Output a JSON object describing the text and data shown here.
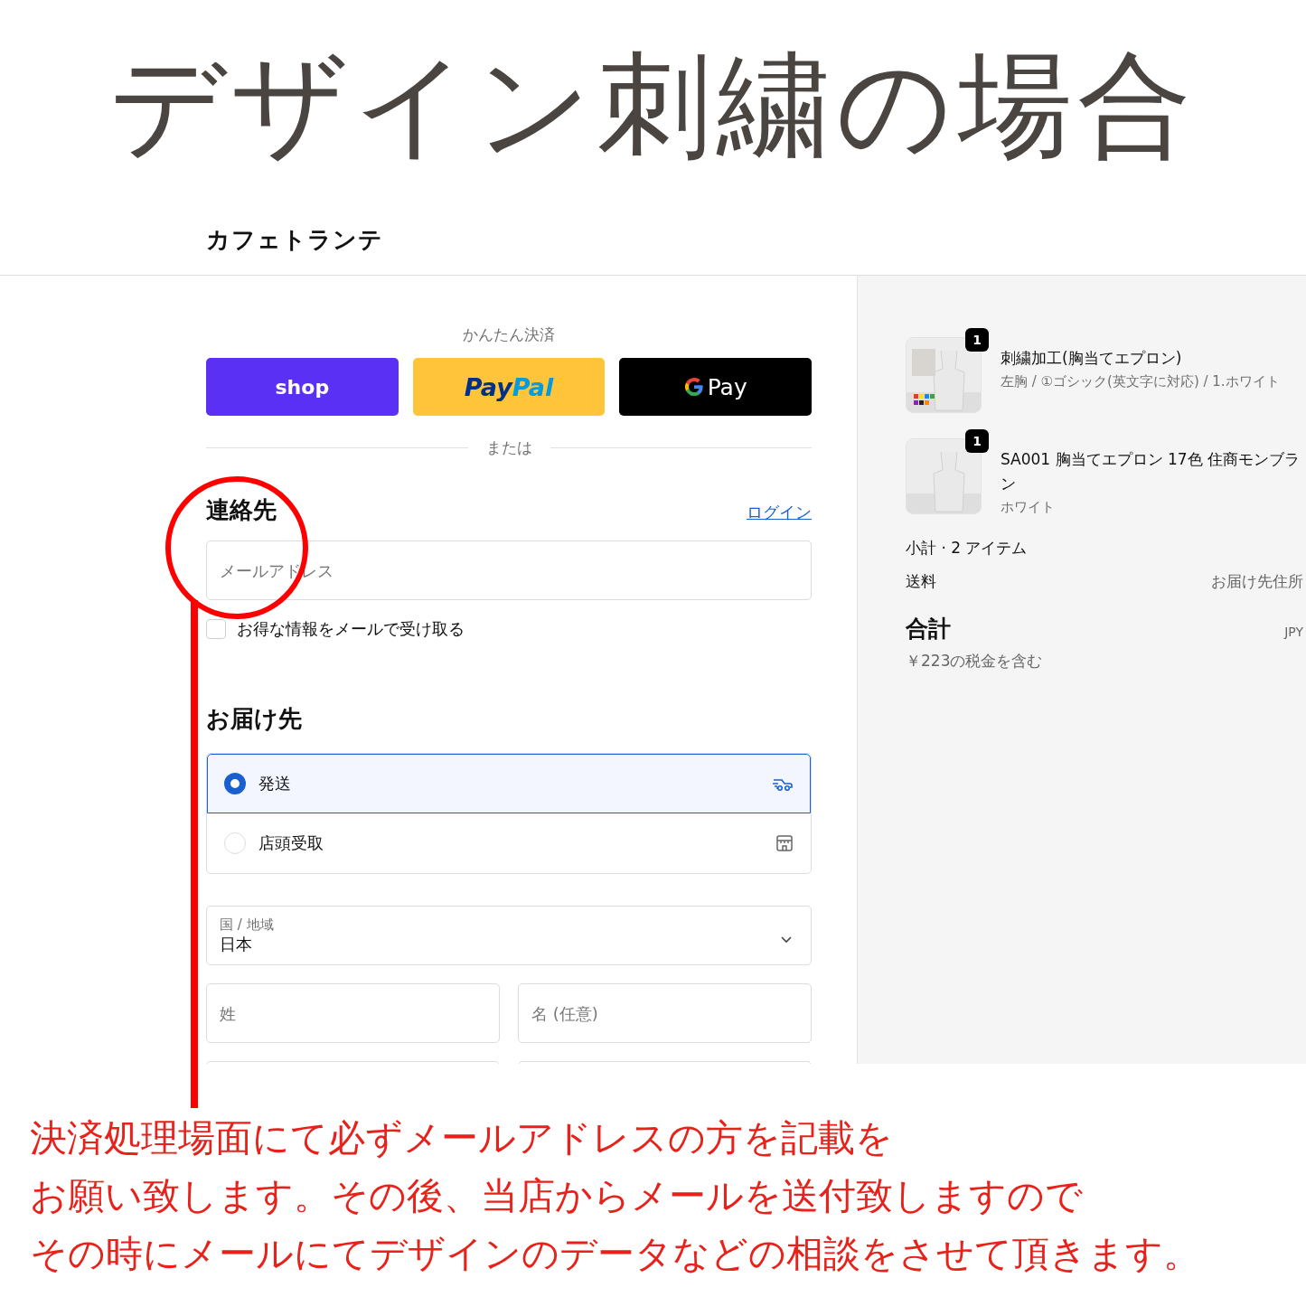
{
  "banner": {
    "title": "デザイン刺繍の場合"
  },
  "store": {
    "name": "カフェトランテ"
  },
  "express": {
    "heading": "かんたん決済",
    "divider": "または",
    "buttons": [
      {
        "kind": "shop",
        "label": "shop"
      },
      {
        "kind": "paypal",
        "label": "Pay",
        "label_2": "Pal"
      },
      {
        "kind": "gpay",
        "label": "Pay"
      }
    ]
  },
  "contact": {
    "heading": "連絡先",
    "login": "ログイン",
    "email": {
      "placeholder": "メールアドレス"
    },
    "newsletter": {
      "label": "お得な情報をメールで受け取る",
      "checked": false
    }
  },
  "delivery": {
    "heading": "お届け先",
    "options": [
      {
        "kind": "ship",
        "label": "発送",
        "selected": true
      },
      {
        "kind": "pickup",
        "label": "店頭受取",
        "selected": false
      }
    ],
    "country": {
      "label": "国 / 地域",
      "value": "日本"
    },
    "last_name": {
      "placeholder": "姓"
    },
    "first_name": {
      "placeholder": "名 (任意)"
    }
  },
  "summary": {
    "items": [
      {
        "name": "刺繍加工(胸当てエプロン)",
        "variant": "左胸 / ①ゴシック(英文字に対応) / 1.ホワイト",
        "quantity": "1"
      },
      {
        "name": "SA001 胸当てエプロン 17色 住商モンブラン",
        "variant": "ホワイト",
        "quantity": "1"
      }
    ],
    "subtotal": "小計 · 2 アイテム",
    "shipping": {
      "label": "送料",
      "value": "お届け先住所"
    },
    "total": {
      "label": "合計",
      "currency": "JPY",
      "tax": "￥223の税金を含む"
    }
  },
  "note": {
    "lines": [
      "決済処理場面にて必ずメールアドレスの方を記載を",
      "お願い致します。その後、当店からメールを送付致しますので",
      "その時にメールにてデザインのデータなどの相談をさせて頂きます。"
    ]
  }
}
